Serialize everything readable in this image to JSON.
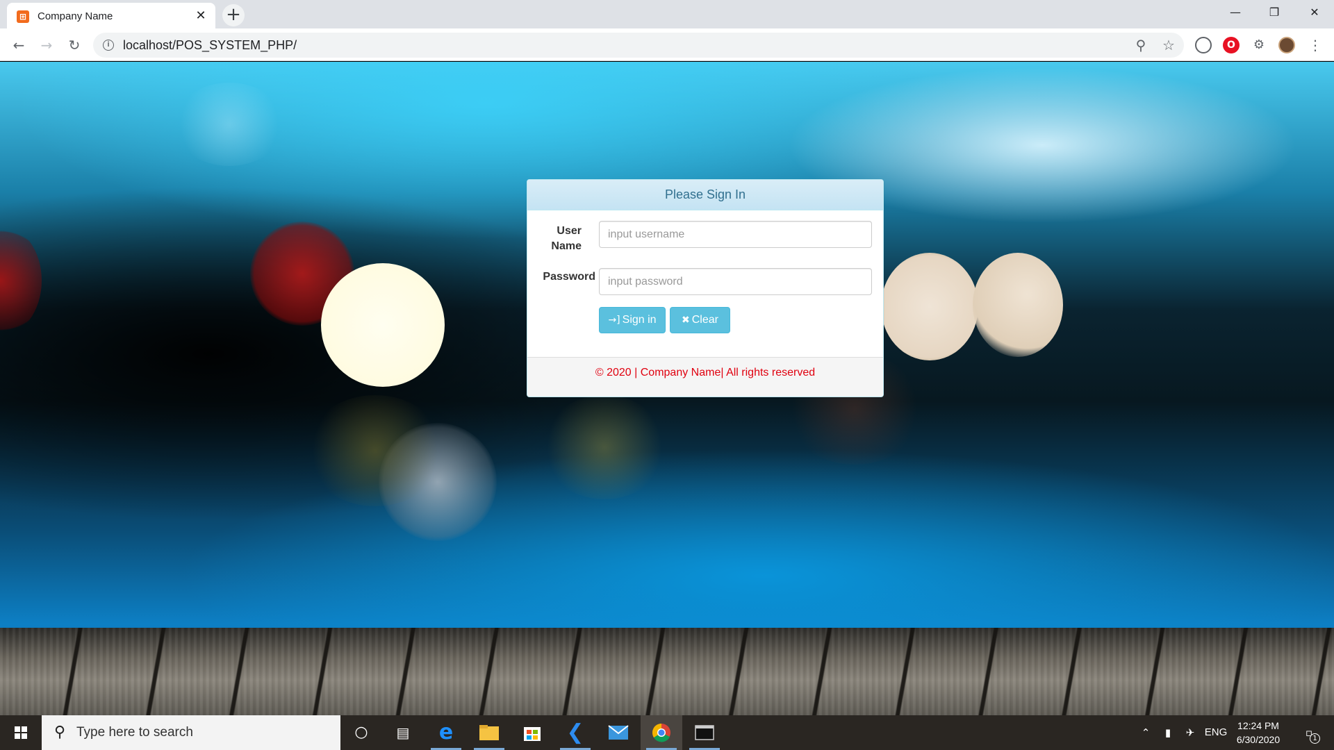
{
  "browser": {
    "tab_title": "Company Name",
    "tab_favicon_glyph": "⊞",
    "tab_close_glyph": "✕",
    "new_tab_glyph": "+",
    "url": "localhost/POS_SYSTEM_PHP/",
    "window_controls": {
      "minimize": "—",
      "maximize": "❐",
      "close": "✕"
    },
    "nav": {
      "back": "←",
      "forward": "→",
      "reload": "↻"
    },
    "omnibox_icons": {
      "zoom": "⚲",
      "star": "☆"
    },
    "menu_glyph": "⋮"
  },
  "login": {
    "heading": "Please Sign In",
    "username_label_line1": "User",
    "username_label_line2": "Name",
    "username_placeholder": "input username",
    "password_label": "Password",
    "password_placeholder": "input password",
    "signin_icon": "→]",
    "signin_label": "Sign in",
    "clear_icon": "✖",
    "clear_label": "Clear",
    "footer": "© 2020 | Company Name| All rights reserved"
  },
  "taskbar": {
    "search_placeholder": "Type here to search",
    "search_glyph": "⚲",
    "tray_language": "ENG",
    "time": "12:24 PM",
    "date": "6/30/2020",
    "notification_count": "1"
  },
  "colors": {
    "panel_heading_text": "#31708f",
    "button_info": "#5bc0de",
    "footer_text": "#e0000f"
  }
}
